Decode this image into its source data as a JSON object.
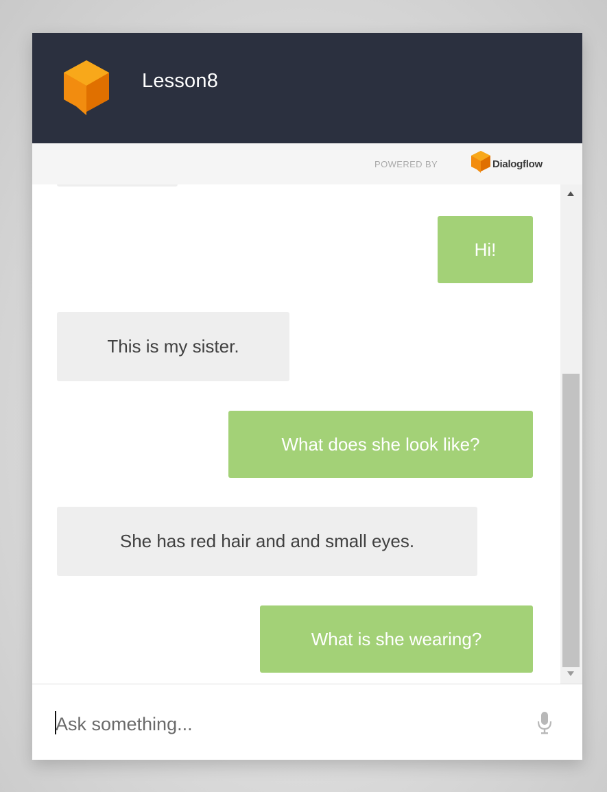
{
  "header": {
    "title": "Lesson8"
  },
  "powered": {
    "label": "POWERED BY",
    "brand": "Dialogflow"
  },
  "messages": [
    {
      "from": "bot",
      "text": ""
    },
    {
      "from": "user",
      "text": "Hi!"
    },
    {
      "from": "bot",
      "text": "This is my sister."
    },
    {
      "from": "user",
      "text": "What does she look like?"
    },
    {
      "from": "bot",
      "text": "She has red hair and and small eyes."
    },
    {
      "from": "user",
      "text": "What is she wearing?"
    }
  ],
  "input": {
    "placeholder": "Ask something..."
  },
  "colors": {
    "header_bg": "#2b303f",
    "user_bubble": "#a3d177",
    "bot_bubble": "#eeeeee",
    "logo_orange": "#f39c12"
  },
  "icons": [
    "dialogflow-logo-icon",
    "scroll-up-icon",
    "scroll-down-icon",
    "microphone-icon"
  ]
}
